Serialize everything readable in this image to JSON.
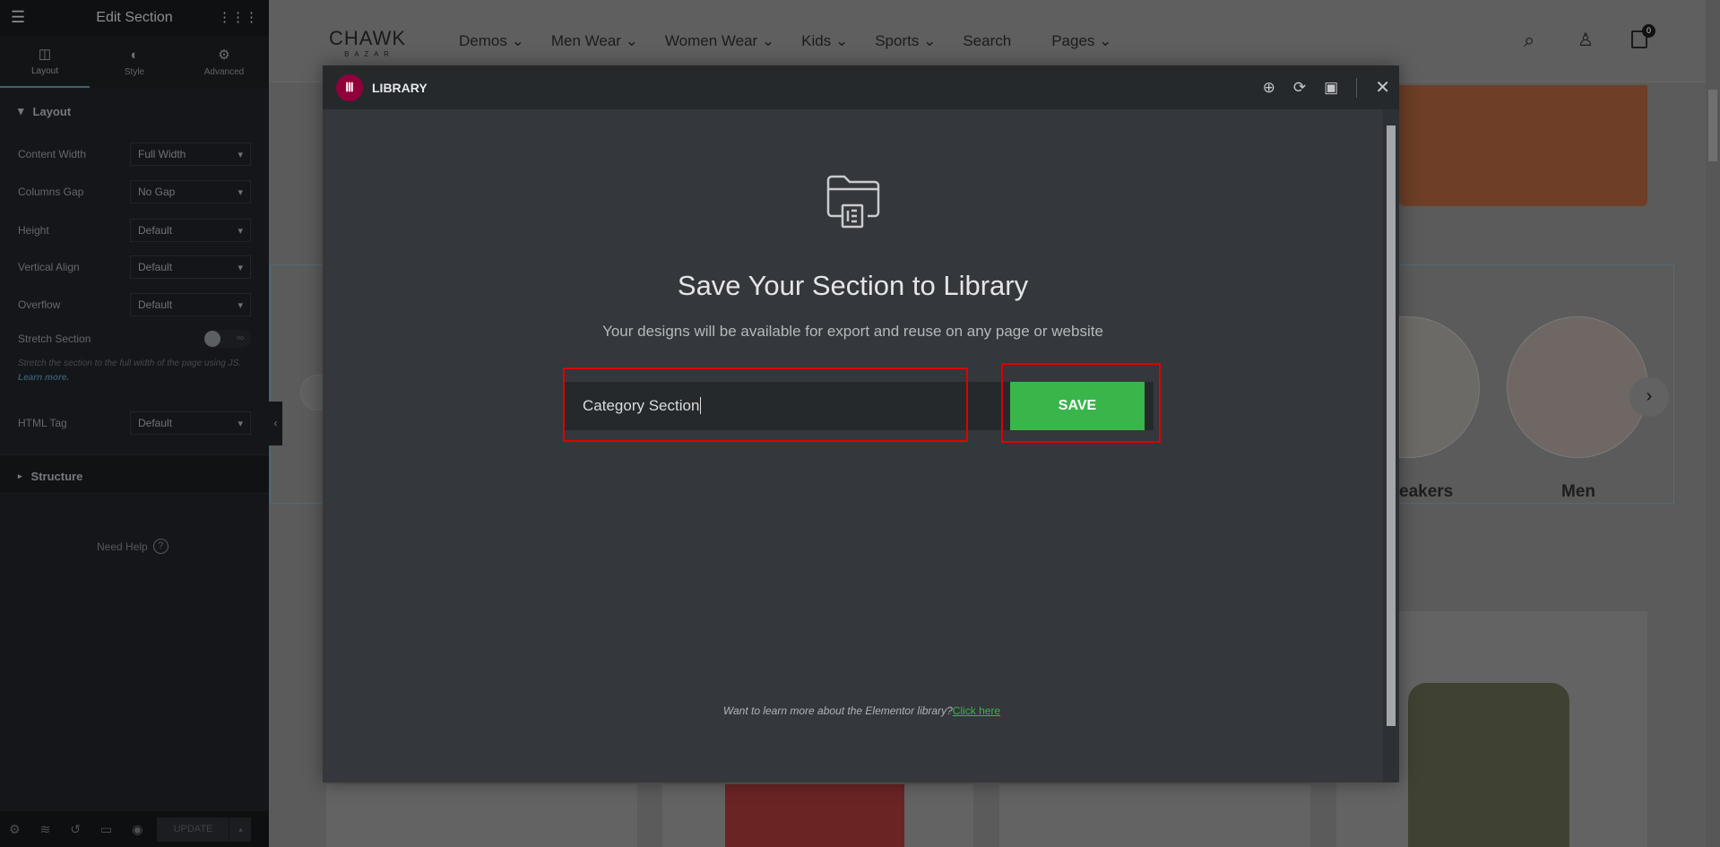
{
  "sidebar": {
    "title": "Edit Section",
    "tabs": [
      {
        "label": "Layout",
        "icon": "columns-icon"
      },
      {
        "label": "Style",
        "icon": "half-circle-icon"
      },
      {
        "label": "Advanced",
        "icon": "gear-icon"
      }
    ],
    "layout_heading": "Layout",
    "fields": [
      {
        "label": "Content Width",
        "value": "Full Width"
      },
      {
        "label": "Columns Gap",
        "value": "No Gap"
      },
      {
        "label": "Height",
        "value": "Default"
      },
      {
        "label": "Vertical Align",
        "value": "Default"
      },
      {
        "label": "Overflow",
        "value": "Default"
      }
    ],
    "stretch": {
      "label": "Stretch Section",
      "toggle": "no",
      "hint": "Stretch the section to the full width of the page using JS.",
      "hint_link": "Learn more."
    },
    "html_tag": {
      "label": "HTML Tag",
      "value": "Default"
    },
    "structure_heading": "Structure",
    "need_help": "Need Help",
    "update_label": "UPDATE"
  },
  "site": {
    "logo": "CHAWK",
    "logo_sub": "B A Z A R",
    "nav": [
      "Demos",
      "Men Wear",
      "Women Wear",
      "Kids",
      "Sports",
      "Search",
      "Pages"
    ],
    "cart_count": "0",
    "categories": [
      "eakers",
      "Men"
    ]
  },
  "modal": {
    "title": "LIBRARY",
    "heading": "Save Your Section to Library",
    "subheading": "Your designs will be available for export and reuse on any page or website",
    "input_value": "Category Section",
    "save_label": "SAVE",
    "footer_text": "Want to learn more about the Elementor library?",
    "footer_link": "Click here"
  },
  "colors": {
    "accent_green": "#39b54a",
    "elementor": "#92003b",
    "highlight": "#e00000"
  }
}
